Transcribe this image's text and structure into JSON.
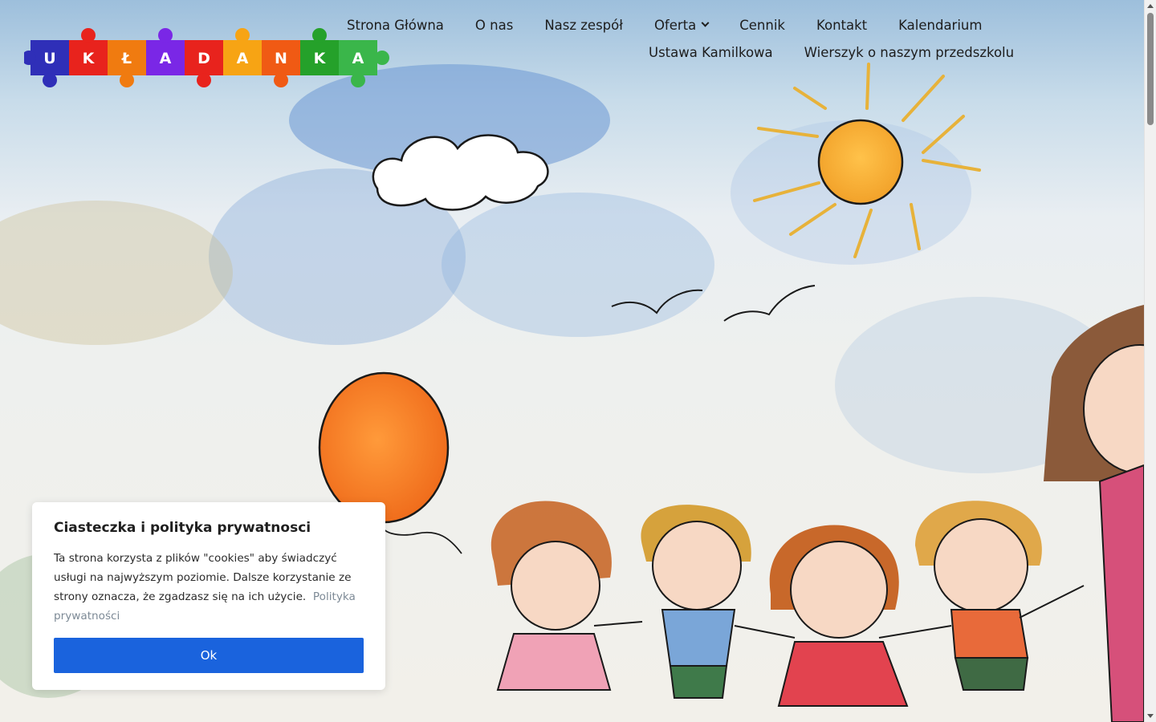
{
  "logo": {
    "letters": [
      "U",
      "K",
      "Ł",
      "A",
      "D",
      "A",
      "N",
      "K",
      "A"
    ],
    "colors": [
      "#2f2fb8",
      "#e8231d",
      "#f07b10",
      "#7a27e6",
      "#e8231d",
      "#f7a414",
      "#f05a14",
      "#25a12a",
      "#3ab64a"
    ]
  },
  "nav": {
    "row1": [
      "Strona Główna",
      "O nas",
      "Nasz zespół",
      "Oferta",
      "Cennik",
      "Kontakt",
      "Kalendarium"
    ],
    "row2": [
      "Ustawa Kamilkowa",
      "Wierszyk o naszym przedszkolu"
    ]
  },
  "cookie": {
    "title": "Ciasteczka i polityka prywatnosci",
    "text": "Ta strona korzysta z plików \"cookies\" aby świadczyć usługi na najwyższym poziomie. Dalsze korzystanie ze strony oznacza, że zgadzasz się na ich użycie.",
    "link": "Polityka prywatności",
    "button": "Ok"
  },
  "colors": {
    "accent": "#1a63dd",
    "link": "#7d8a96"
  }
}
